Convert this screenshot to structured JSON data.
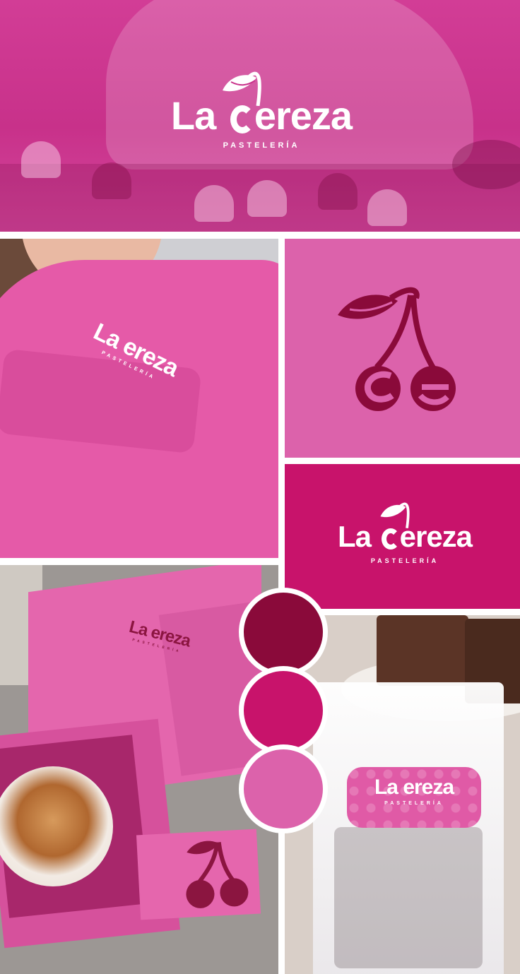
{
  "brand": {
    "name": "La Cereza",
    "name_first": "La",
    "name_second": "ereza",
    "tagline": "PASTELERÍA"
  },
  "colors": {
    "dark_cherry": "#8a0a3a",
    "magenta": "#c8136b",
    "light_pink": "#dc62ab",
    "white": "#ffffff"
  },
  "swatches": [
    {
      "name": "dark-cherry",
      "color": "#8a0a3a"
    },
    {
      "name": "magenta",
      "color": "#c8136b"
    },
    {
      "name": "light-pink",
      "color": "#dc62ab"
    }
  ],
  "icons": {
    "cherry": "cherry-icon",
    "leaf": "leaf-icon"
  }
}
